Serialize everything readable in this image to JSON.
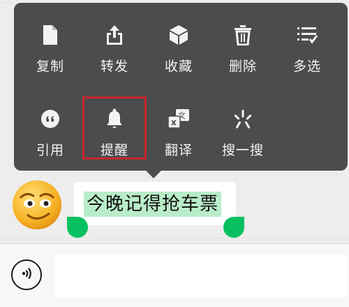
{
  "menu": {
    "row1": [
      {
        "label": "复制",
        "icon": "copy-icon"
      },
      {
        "label": "转发",
        "icon": "forward-icon"
      },
      {
        "label": "收藏",
        "icon": "favorite-icon"
      },
      {
        "label": "删除",
        "icon": "delete-icon"
      },
      {
        "label": "多选",
        "icon": "multi-select-icon"
      }
    ],
    "row2": [
      {
        "label": "引用",
        "icon": "quote-icon"
      },
      {
        "label": "提醒",
        "icon": "bell-icon",
        "highlighted": true
      },
      {
        "label": "翻译",
        "icon": "translate-icon"
      },
      {
        "label": "搜一搜",
        "icon": "search-one-icon"
      }
    ]
  },
  "message": {
    "text": "今晚记得抢车票",
    "selected": true
  },
  "colors": {
    "menu_bg": "#4c4c4c",
    "highlight_border": "#c7272d",
    "selection_bg": "#b9ecc8",
    "handle": "#07c160"
  }
}
